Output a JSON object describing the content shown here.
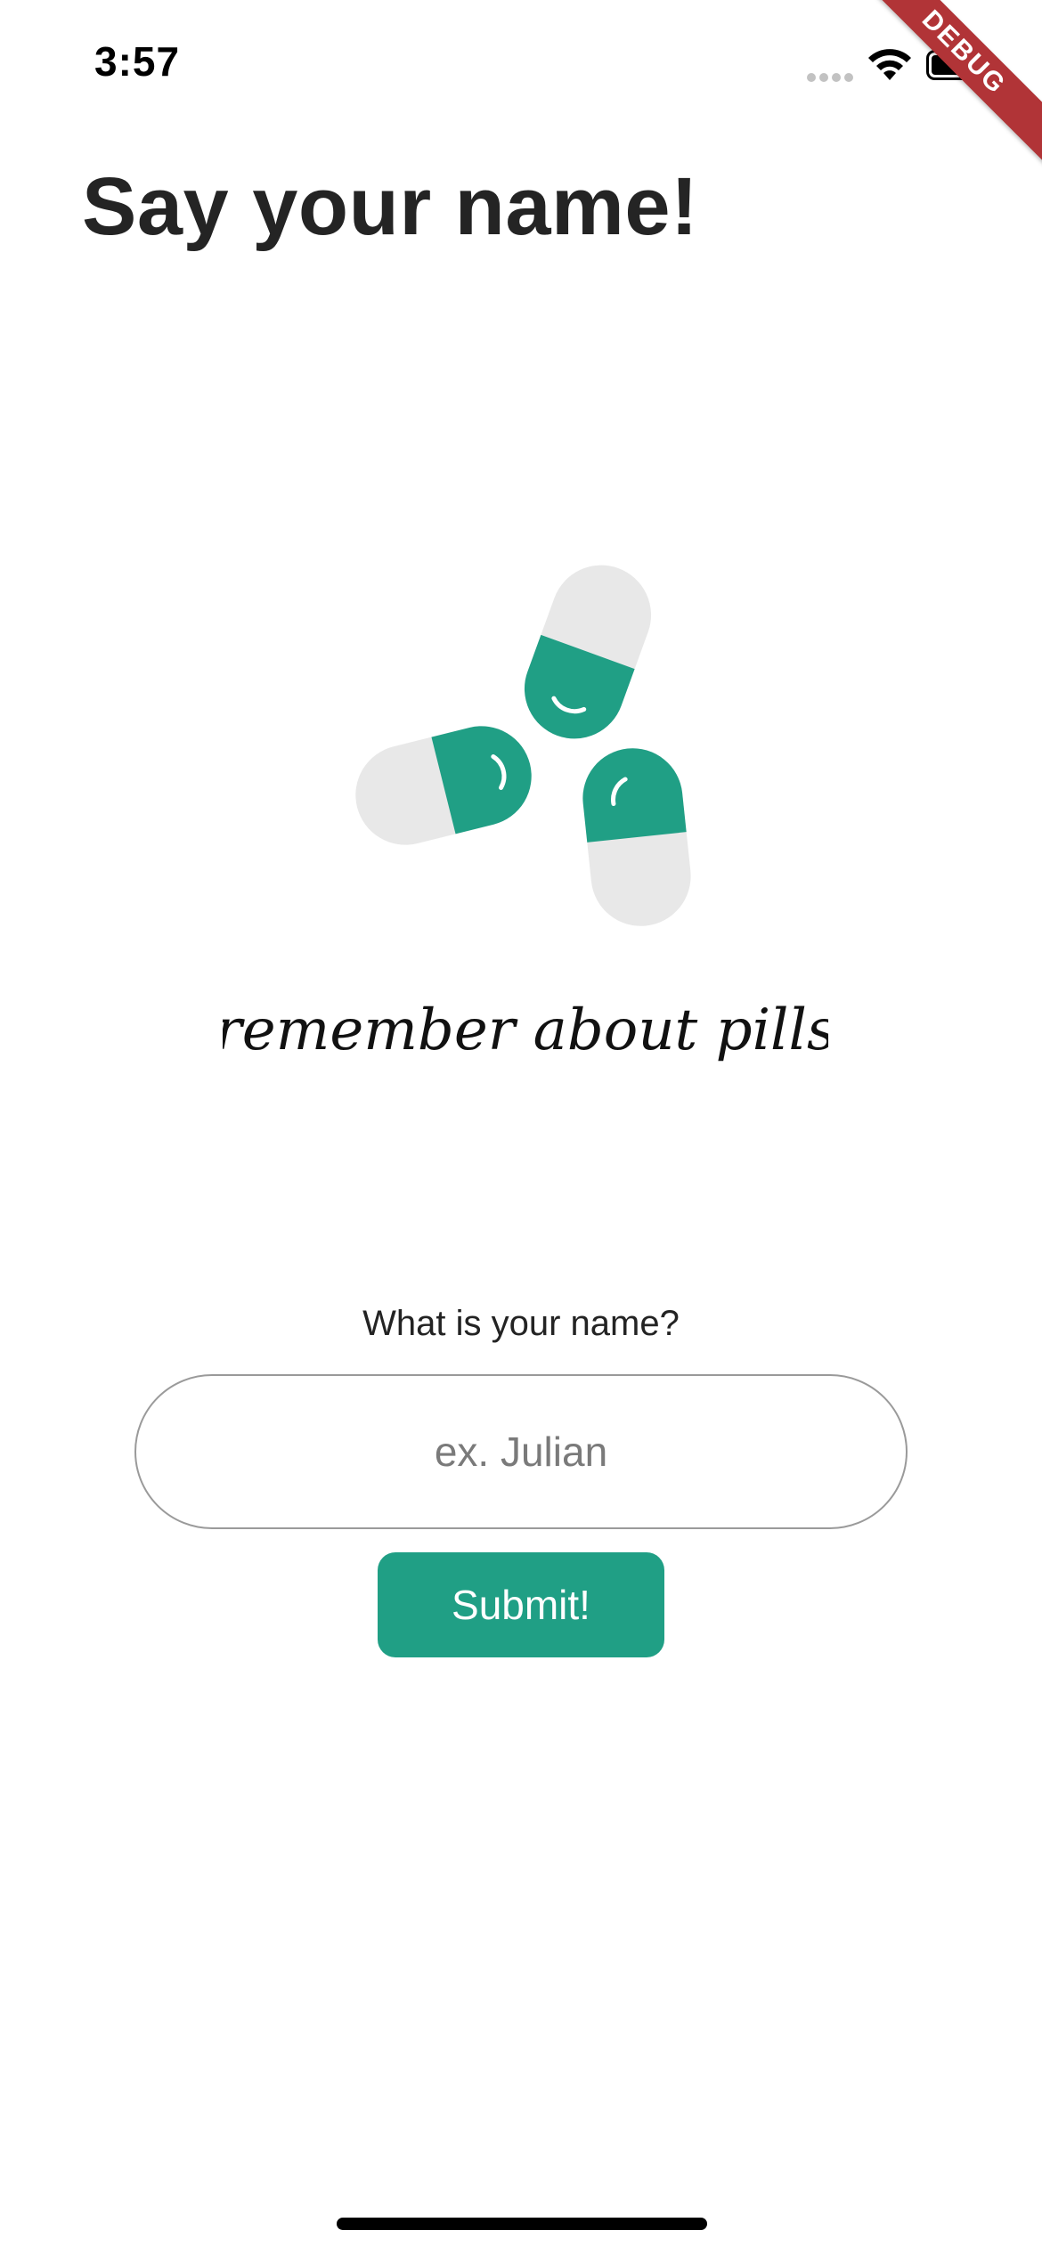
{
  "status_bar": {
    "time": "3:57",
    "icons": [
      "cellular-signal-icon",
      "wifi-icon",
      "battery-icon"
    ]
  },
  "debug_banner": "DEBUG",
  "header": {
    "title": "Say your name!"
  },
  "logo": {
    "tagline": "remember about pills",
    "colors": {
      "pill_green": "#209f85",
      "pill_gray": "#e8e8e8"
    }
  },
  "form": {
    "label": "What is your name?",
    "name_input": {
      "value": "",
      "placeholder": "ex. Julian"
    },
    "submit_label": "Submit!"
  },
  "colors": {
    "accent": "#209f85",
    "debug_banner": "#b13437"
  }
}
